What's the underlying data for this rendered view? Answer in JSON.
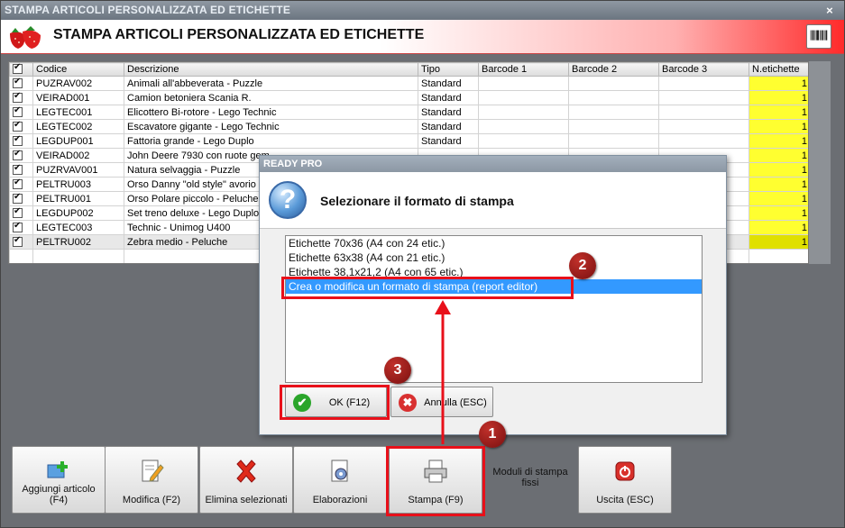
{
  "window": {
    "title": "STAMPA ARTICOLI PERSONALIZZATA ED ETICHETTE",
    "close_glyph": "×"
  },
  "header": {
    "title": "STAMPA ARTICOLI PERSONALIZZATA ED ETICHETTE"
  },
  "grid": {
    "columns": [
      "Codice",
      "Descrizione",
      "Tipo",
      "Barcode 1",
      "Barcode 2",
      "Barcode 3",
      "N.etichette"
    ],
    "rows": [
      {
        "codice": "PUZRAV002",
        "descrizione": "Animali all'abbeverata - Puzzle",
        "tipo": "Standard",
        "n": "1"
      },
      {
        "codice": "VEIRAD001",
        "descrizione": "Camion betoniera Scania R.",
        "tipo": "Standard",
        "n": "1"
      },
      {
        "codice": "LEGTEC001",
        "descrizione": "Elicottero Bi-rotore - Lego Technic",
        "tipo": "Standard",
        "n": "1"
      },
      {
        "codice": "LEGTEC002",
        "descrizione": "Escavatore gigante - Lego Technic",
        "tipo": "Standard",
        "n": "1"
      },
      {
        "codice": "LEGDUP001",
        "descrizione": "Fattoria grande - Lego Duplo",
        "tipo": "Standard",
        "n": "1"
      },
      {
        "codice": "VEIRAD002",
        "descrizione": "John Deere 7930 con ruote gem",
        "tipo": "",
        "n": "1"
      },
      {
        "codice": "PUZRVAV001",
        "descrizione": "Natura selvaggia - Puzzle",
        "tipo": "",
        "n": "1"
      },
      {
        "codice": "PELTRU003",
        "descrizione": "Orso Danny \"old style\" avorio",
        "tipo": "",
        "n": "1"
      },
      {
        "codice": "PELTRU001",
        "descrizione": "Orso Polare piccolo - Peluche",
        "tipo": "",
        "n": "1"
      },
      {
        "codice": "LEGDUP002",
        "descrizione": "Set treno deluxe - Lego Duplo",
        "tipo": "",
        "n": "1"
      },
      {
        "codice": "LEGTEC003",
        "descrizione": "Technic - Unimog U400",
        "tipo": "",
        "n": "1"
      },
      {
        "codice": "PELTRU002",
        "descrizione": "Zebra medio - Peluche",
        "tipo": "",
        "n": "1"
      }
    ]
  },
  "dialog": {
    "title": "READY PRO",
    "message": "Selezionare il formato di stampa",
    "items": [
      "Etichette 70x36 (A4 con 24 etic.)",
      "Etichette 63x38 (A4 con 21 etic.)",
      "Etichette 38,1x21,2 (A4 con 65 etic.)",
      "Crea o modifica un formato di stampa (report editor)"
    ],
    "ok_label": "OK (F12)",
    "cancel_label": "Annulla (ESC)"
  },
  "toolbar": {
    "add_label": "Aggiungi articolo (F4)",
    "edit_label": "Modifica (F2)",
    "delete_label": "Elimina selezionati",
    "process_label": "Elaborazioni",
    "print_label": "Stampa (F9)",
    "modules_label": "Moduli di stampa fissi",
    "exit_label": "Uscita (ESC)"
  },
  "annotations": {
    "m1": "1",
    "m2": "2",
    "m3": "3"
  },
  "colors": {
    "accent_red": "#e8101a",
    "selection_blue": "#3399ff",
    "count_yellow": "#ffff30"
  }
}
